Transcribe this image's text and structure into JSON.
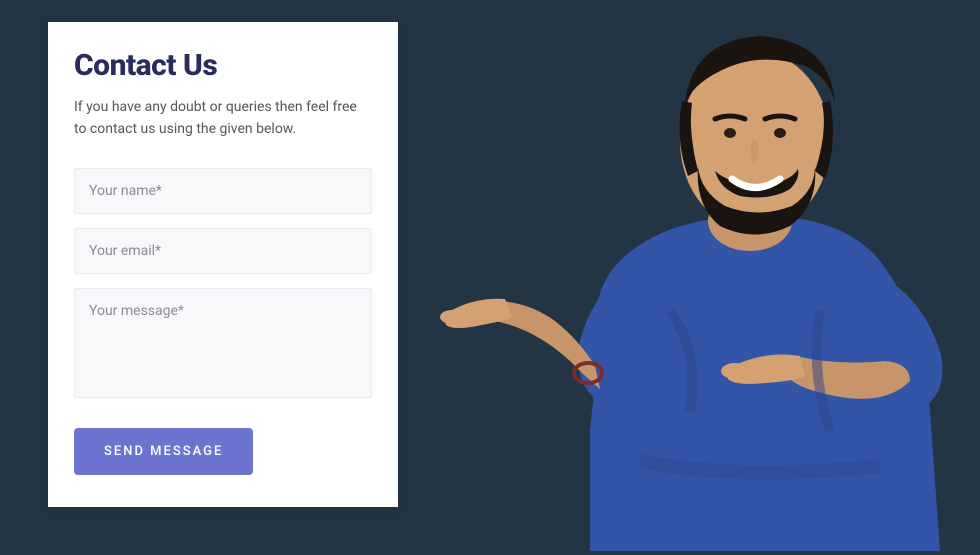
{
  "card": {
    "title": "Contact Us",
    "subtitle": "If you have any doubt or queries then feel free to contact us using the given below."
  },
  "form": {
    "name_placeholder": "Your name*",
    "email_placeholder": "Your email*",
    "message_placeholder": "Your message*",
    "submit_label": "SEND MESSAGE"
  },
  "figure": {
    "description": "person-pointing-left"
  }
}
